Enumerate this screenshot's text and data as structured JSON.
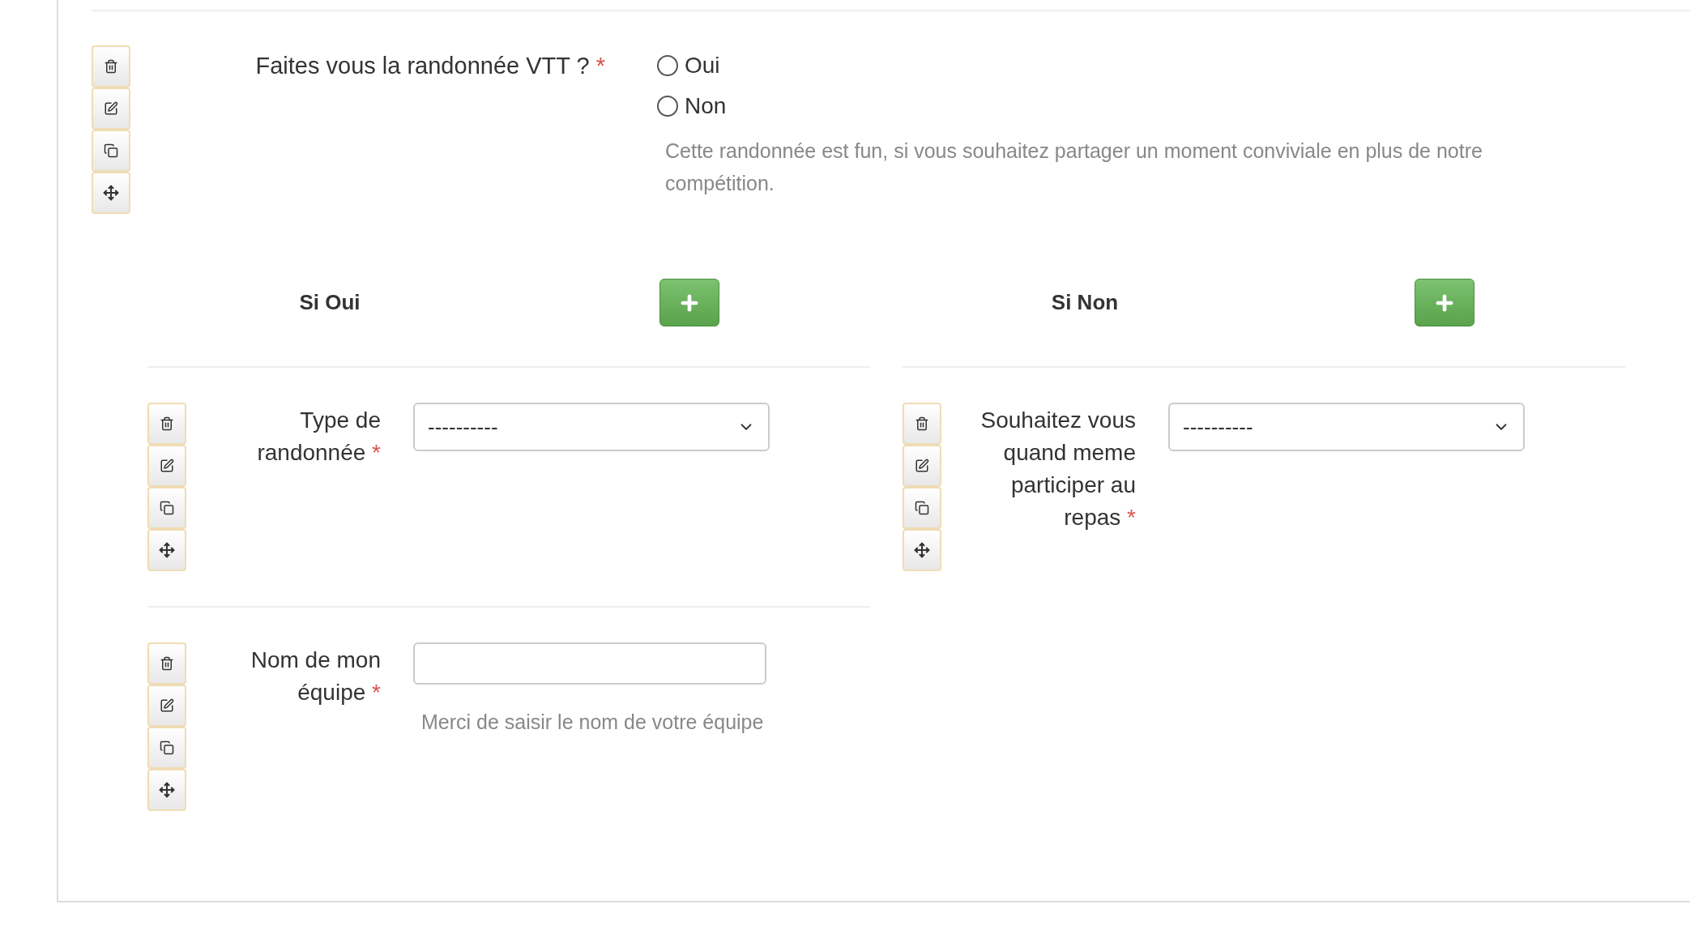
{
  "question": {
    "label": "Faites vous la randonnée VTT ?",
    "required_mark": "*",
    "options": [
      {
        "label": "Oui",
        "selected": false
      },
      {
        "label": "Non",
        "selected": false
      }
    ],
    "help": "Cette randonnée est fun, si vous souhaitez partager un moment conviviale en plus de notre compétition."
  },
  "branches": [
    {
      "title": "Si Oui",
      "fields": [
        {
          "kind": "select",
          "label": "Type de randonnée",
          "required_mark": "*",
          "value": "----------"
        },
        {
          "kind": "text",
          "label": "Nom de mon équipe",
          "required_mark": "*",
          "help": "Merci de saisir le nom de votre équipe"
        }
      ]
    },
    {
      "title": "Si Non",
      "fields": [
        {
          "kind": "select",
          "label": "Souhaitez vous quand meme participer au repas",
          "required_mark": "*",
          "value": "----------"
        }
      ]
    }
  ]
}
